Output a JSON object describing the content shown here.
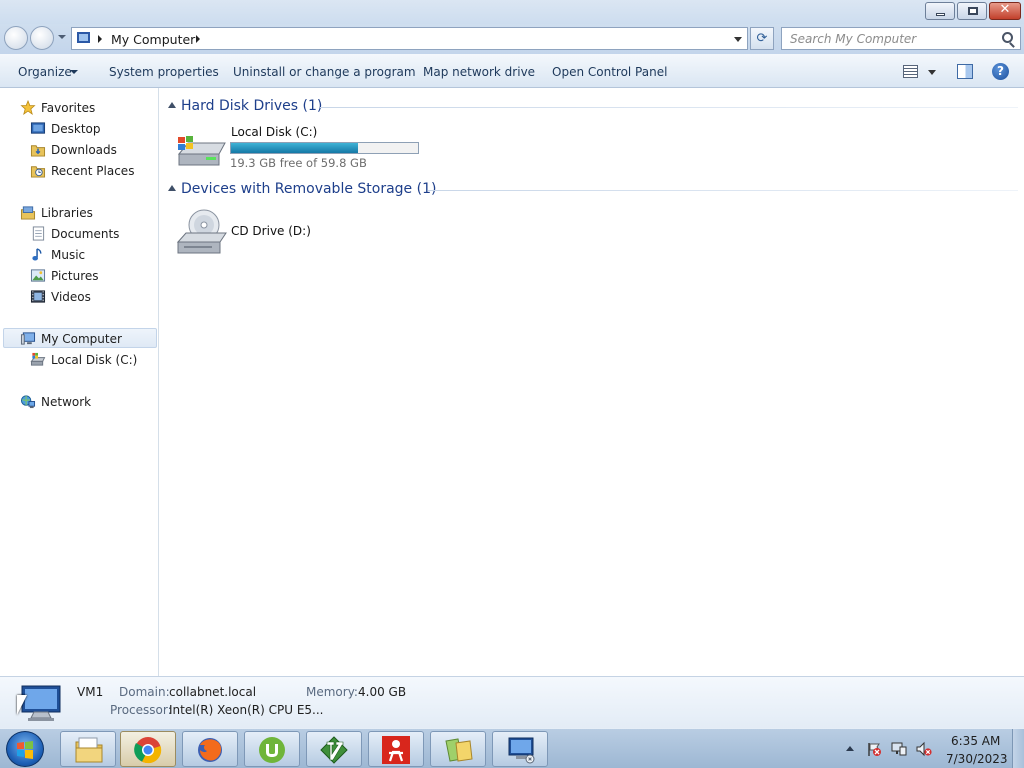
{
  "window": {
    "close_glyph": "✕"
  },
  "address": {
    "path": "My Computer",
    "refresh_glyph": "⟳"
  },
  "search": {
    "placeholder": "Search My Computer"
  },
  "toolbar": {
    "organize": "Organize",
    "system_properties": "System properties",
    "uninstall": "Uninstall or change a program",
    "map_network_drive": "Map network drive",
    "open_control_panel": "Open Control Panel",
    "help_glyph": "?"
  },
  "sidebar": {
    "favorites": {
      "label": "Favorites",
      "items": [
        {
          "label": "Desktop",
          "icon": "desktop-icon"
        },
        {
          "label": "Downloads",
          "icon": "downloads-folder-icon"
        },
        {
          "label": "Recent Places",
          "icon": "recent-places-icon"
        }
      ]
    },
    "libraries": {
      "label": "Libraries",
      "items": [
        {
          "label": "Documents",
          "icon": "documents-icon"
        },
        {
          "label": "Music",
          "icon": "music-icon"
        },
        {
          "label": "Pictures",
          "icon": "pictures-icon"
        },
        {
          "label": "Videos",
          "icon": "videos-icon"
        }
      ]
    },
    "computer": {
      "label": "My Computer",
      "selected": true,
      "items": [
        {
          "label": "Local Disk (C:)",
          "icon": "local-disk-icon"
        }
      ]
    },
    "network": {
      "label": "Network"
    }
  },
  "content": {
    "hard_disks": {
      "title": "Hard Disk Drives (1)",
      "drive": {
        "name": "Local Disk (C:)",
        "free_text": "19.3 GB free of 59.8 GB",
        "free_gb": 19.3,
        "total_gb": 59.8,
        "used_fraction": 0.677
      }
    },
    "removable": {
      "title": "Devices with Removable Storage (1)",
      "drive": {
        "name": "CD Drive (D:)"
      }
    }
  },
  "details": {
    "name": "VM1",
    "domain_label": "Domain:",
    "domain_value": "collabnet.local",
    "memory_label": "Memory:",
    "memory_value": "4.00 GB",
    "processor_label": "Processor:",
    "processor_value": "Intel(R) Xeon(R) CPU E5..."
  },
  "taskbar": {
    "pinned": [
      "file-explorer-icon",
      "chrome-icon",
      "firefox-icon",
      "utorrent-icon",
      "vim-icon",
      "app-red-icon",
      "folders-icon",
      "my-computer-icon"
    ],
    "clock_time": "6:35 AM",
    "clock_date": "7/30/2023"
  },
  "colors": {
    "group_title": "#1e3f8b",
    "capacity_fill": "#1c8ec0",
    "command_text": "#1e395b"
  }
}
